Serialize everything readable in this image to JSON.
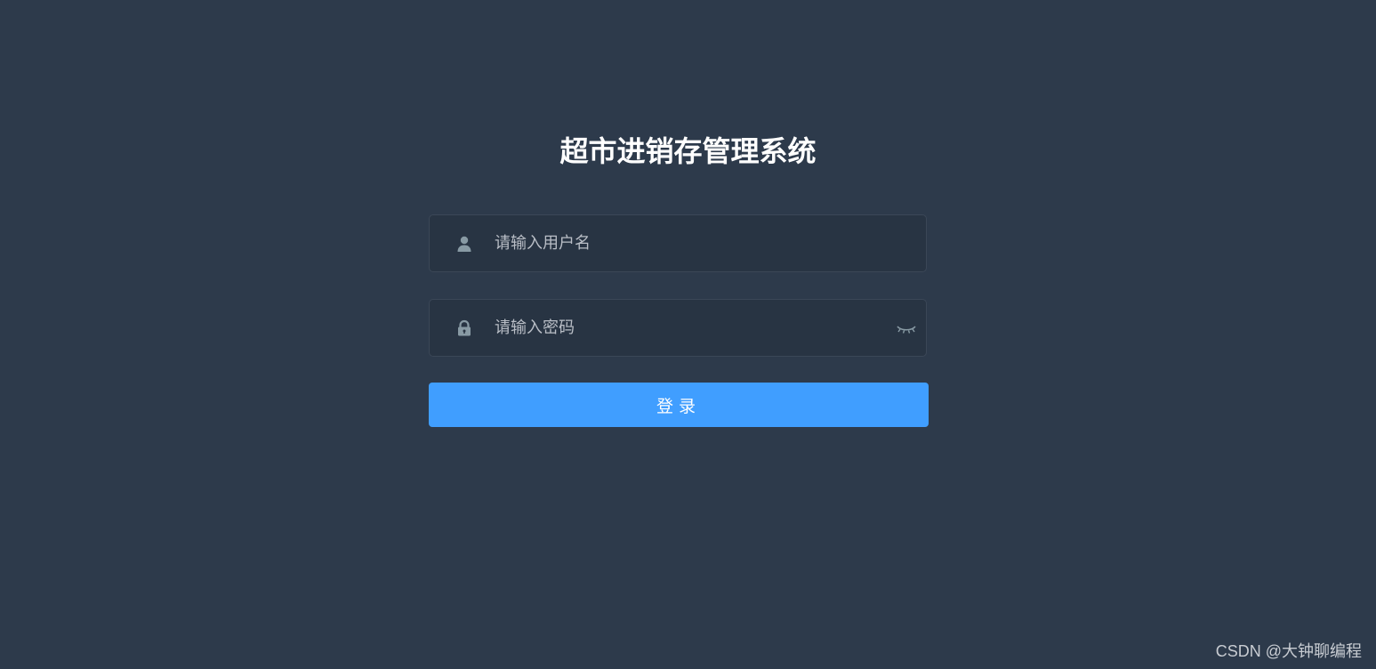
{
  "app": {
    "title": "超市进销存管理系统"
  },
  "login_form": {
    "username": {
      "placeholder": "请输入用户名",
      "value": "",
      "icon": "user-icon"
    },
    "password": {
      "placeholder": "请输入密码",
      "value": "",
      "icon": "lock-icon",
      "toggle_icon": "eye-closed-icon"
    },
    "submit_label": "登录"
  },
  "watermark": {
    "text": "CSDN @大钟聊编程"
  },
  "colors": {
    "background": "#2d3a4b",
    "input_background": "#283443",
    "button": "#409eff",
    "title": "#ffffff"
  }
}
